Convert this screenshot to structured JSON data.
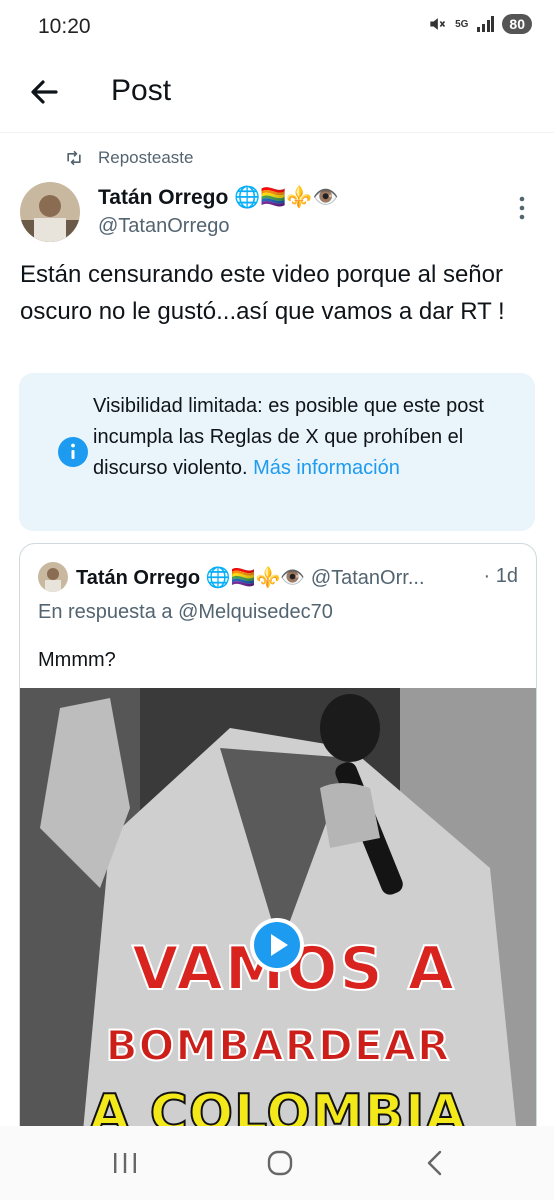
{
  "status_bar": {
    "time": "10:20",
    "network_label": "5G",
    "battery": "80"
  },
  "header": {
    "title": "Post"
  },
  "repost": {
    "label": "Reposteaste"
  },
  "post": {
    "author_name": "Tatán Orrego 🌐🏳️‍🌈⚜️👁️",
    "author_handle": "@TatanOrrego",
    "text": "Están censurando este video porque al señor oscuro no le gustó...así que vamos a dar RT !"
  },
  "notice": {
    "text": "Visibilidad limitada: es posible que este post incumpla las Reglas de X que prohíben el discurso violento.",
    "link": "Más información"
  },
  "quote": {
    "author_name": "Tatán Orrego 🌐🏳️‍🌈⚜️👁️",
    "author_handle": "@TatanOrr...",
    "time": "· 1d",
    "reply_to": "En respuesta a @Melquisedec70",
    "text": "Mmmm?",
    "video_caption_1": "VAMOS A",
    "video_caption_2": "BOMBARDEAR",
    "video_caption_3": "A COLOMBIA"
  },
  "colors": {
    "accent": "#1d9bf0",
    "secondary_text": "#536471",
    "notice_bg": "#eaf4fb"
  },
  "icons": [
    "mute-icon",
    "signal-icon",
    "back-arrow-icon",
    "repost-icon",
    "more-vertical-icon",
    "info-icon",
    "play-icon",
    "recent-apps-icon",
    "home-icon",
    "nav-back-icon"
  ]
}
